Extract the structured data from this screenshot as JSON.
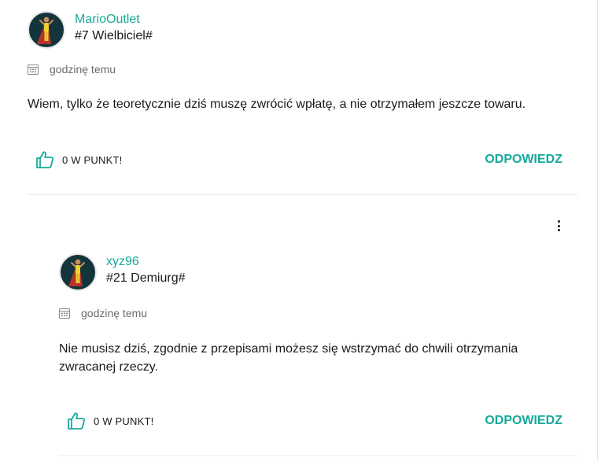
{
  "comments": [
    {
      "username": "MarioOutlet",
      "rank": "#7 Wielbiciel#",
      "time": "godzinę temu",
      "text": "Wiem, tylko że teoretycznie dziś muszę zwrócić wpłatę, a nie otrzymałem jeszcze towaru.",
      "points": "0 W PUNKT!",
      "reply_label": "ODPOWIEDZ"
    },
    {
      "username": "xyz96",
      "rank": "#21 Demiurg#",
      "time": "godzinę temu",
      "text": "Nie musisz dziś, zgodnie z przepisami możesz się wstrzymać do chwili otrzymania zwracanej rzeczy.",
      "points": "0 W PUNKT!",
      "reply_label": "ODPOWIEDZ"
    }
  ],
  "colors": {
    "accent": "#16a99a",
    "avatar_bg": "#14343b",
    "cape": "#b7322c",
    "text": "#1a1a1a",
    "muted": "#6b6b6b"
  },
  "icons": {
    "avatar": "superhero-avatar-icon",
    "time": "calendar-icon",
    "like": "thumbs-up-icon",
    "menu": "more-vertical-icon"
  }
}
